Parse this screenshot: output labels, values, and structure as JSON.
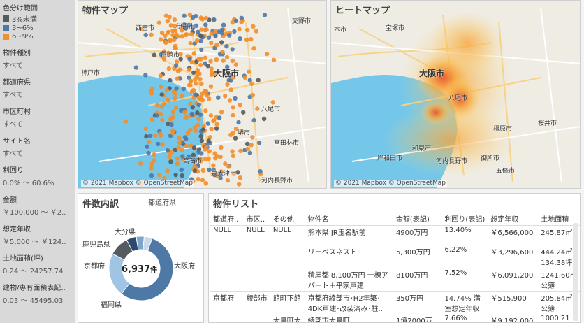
{
  "sidebar": {
    "color_title": "色分け範囲",
    "legend": [
      {
        "label": "3%未満",
        "color": "#555b61"
      },
      {
        "label": "3~6%",
        "color": "#4e79a7"
      },
      {
        "label": "6~9%",
        "color": "#f28e2b"
      }
    ],
    "filters": [
      {
        "label": "物件種別",
        "value": "すべて"
      },
      {
        "label": "都道府県",
        "value": "すべて"
      },
      {
        "label": "市区町村",
        "value": "すべて"
      },
      {
        "label": "サイト名",
        "value": "すべて"
      },
      {
        "label": "利回り",
        "value": "0.0% ～ 60.6%"
      },
      {
        "label": "金額",
        "value": "￥100,000 ～ ￥2.."
      },
      {
        "label": "想定年収",
        "value": "￥5,000 ～ ￥124.."
      },
      {
        "label": "土地面積(坪)",
        "value": "0.24 ～ 24257.74"
      },
      {
        "label": "建物/専有面積表記..",
        "value": "0.03 ～ 45495.03"
      }
    ]
  },
  "map1": {
    "title": "物件マップ",
    "attribution": "© 2021 Mapbox © OpenStreetMap",
    "places": [
      "西宮市",
      "伊丹市",
      "交野市",
      "尼崎市",
      "神戸市",
      "大阪市",
      "八尾市",
      "堺市",
      "高石市",
      "泉大津市",
      "富田林市",
      "河内長野市"
    ]
  },
  "map2": {
    "title": "ヒートマップ",
    "attribution": "© 2021 Mapbox © OpenStreetMap",
    "places": [
      "宝塚市",
      "木市",
      "大阪市",
      "八尾市",
      "橿原市",
      "岸和田市",
      "和泉市",
      "河内長野市",
      "御所市",
      "桜井市",
      "五條市"
    ]
  },
  "donut": {
    "title": "件数内訳",
    "subtitle": "都道府県",
    "center_value": "6,937",
    "center_unit": "件",
    "segments": [
      {
        "label": "大阪府",
        "value": 0.55,
        "color": "#4e79a7"
      },
      {
        "label": "福岡県",
        "value": 0.22,
        "color": "#a0c4e4"
      },
      {
        "label": "京都府",
        "value": 0.1,
        "color": "#555b61"
      },
      {
        "label": "鹿児島県",
        "value": 0.05,
        "color": "#2b4a6f"
      },
      {
        "label": "大分県",
        "value": 0.04,
        "color": "#7fa6c9"
      },
      {
        "label": "",
        "value": 0.04,
        "color": "#c7d9ea"
      }
    ]
  },
  "table": {
    "title": "物件リスト",
    "headers": [
      "都道府..",
      "市区..",
      "その他",
      "物件名",
      "金額(表記)",
      "利回り(表記)",
      "想定年収",
      "土地面積"
    ],
    "rows": [
      [
        "NULL",
        "NULL",
        "NULL",
        "熊本県 JR玉名駅前",
        "4900万円",
        "13.40%",
        "￥6,566,000",
        "245.87㎡"
      ],
      [
        "",
        "",
        "",
        "リーベスネスト",
        "5,300万円",
        "6.22%",
        "￥3,296,600",
        "444.24㎡ 134.38坪"
      ],
      [
        "",
        "",
        "",
        "積屋都 8,100万円 一棟アパート＋平家戸建",
        "8100万円",
        "7.52%",
        "￥6,091,200",
        "1241.60㎡ 公簿"
      ],
      [
        "京都府",
        "綾部市",
        "館町下館",
        "京都府綾部市･H2年築･4DK戸建･改装済み･駐..",
        "350万円",
        "14.74% 満室想定年収",
        "￥515,900",
        "205.84㎡ 公簿"
      ],
      [
        "",
        "",
        "大島町大",
        "綾部市大島町",
        "1億2000万",
        "7.66%",
        "￥9,192,000",
        "1000.21"
      ]
    ]
  }
}
